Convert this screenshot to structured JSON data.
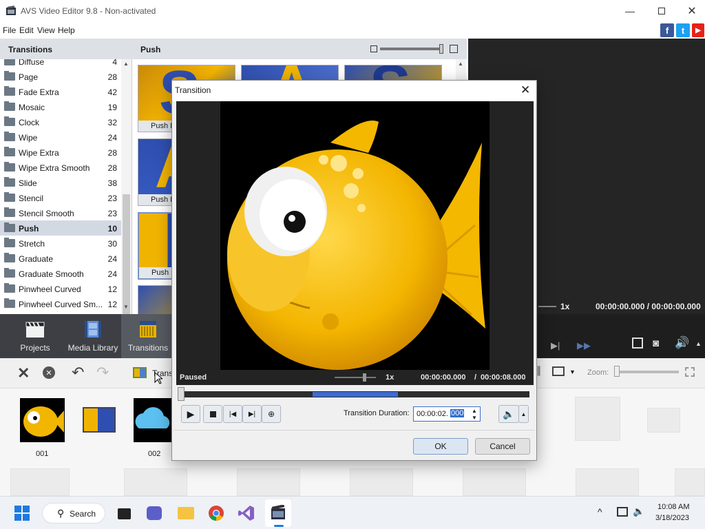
{
  "window": {
    "title": "AVS Video Editor 9.8 - Non-activated"
  },
  "menu": [
    "File",
    "Edit",
    "View",
    "Help"
  ],
  "social": [
    {
      "name": "facebook",
      "color": "#3b5998",
      "glyph": "f"
    },
    {
      "name": "twitter",
      "color": "#1da1f2",
      "glyph": "t"
    },
    {
      "name": "youtube",
      "color": "#e62117",
      "glyph": "▶"
    }
  ],
  "left_panel": {
    "header": "Transitions",
    "items": [
      {
        "name": "Diffuse",
        "count": "4"
      },
      {
        "name": "Page",
        "count": "28"
      },
      {
        "name": "Fade Extra",
        "count": "42"
      },
      {
        "name": "Mosaic",
        "count": "19"
      },
      {
        "name": "Clock",
        "count": "32"
      },
      {
        "name": "Wipe",
        "count": "24"
      },
      {
        "name": "Wipe Extra",
        "count": "28"
      },
      {
        "name": "Wipe Extra Smooth",
        "count": "28"
      },
      {
        "name": "Slide",
        "count": "38"
      },
      {
        "name": "Stencil",
        "count": "23"
      },
      {
        "name": "Stencil Smooth",
        "count": "23"
      },
      {
        "name": "Push",
        "count": "10",
        "selected": true
      },
      {
        "name": "Stretch",
        "count": "30"
      },
      {
        "name": "Graduate",
        "count": "24"
      },
      {
        "name": "Graduate Smooth",
        "count": "24"
      },
      {
        "name": "Pinwheel Curved",
        "count": "12"
      },
      {
        "name": "Pinwheel Curved Sm...",
        "count": "12"
      }
    ]
  },
  "mid_panel": {
    "header": "Push",
    "thumbs": [
      "Push D",
      "Push Do",
      "Push Si"
    ]
  },
  "preview": {
    "speed": "1x",
    "time": "00:00:00.000 / 00:00:00.000"
  },
  "tabs": [
    {
      "label": "Projects"
    },
    {
      "label": "Media Library"
    },
    {
      "label": "Transitions"
    }
  ],
  "timeline_toolbar": {
    "transition_label": "Transi",
    "zoom_label": "Zoom:"
  },
  "timeline": {
    "clips": [
      {
        "label": "001"
      },
      {
        "label": "002"
      }
    ]
  },
  "dialog": {
    "title": "Transition",
    "status": "Paused",
    "speed": "1x",
    "time_current": "00:00:00.000",
    "time_sep": "/",
    "time_total": "00:00:08.000",
    "duration_label": "Transition Duration:",
    "duration_prefix": "00:00:02.",
    "duration_selected": "000",
    "ok": "OK",
    "cancel": "Cancel"
  },
  "taskbar": {
    "search": "Search",
    "time": "10:08 AM",
    "date": "3/18/2023"
  },
  "colors": {
    "accent": "#3b82f6",
    "tab_bg": "#3d3f44",
    "fish": "#f5b800"
  }
}
